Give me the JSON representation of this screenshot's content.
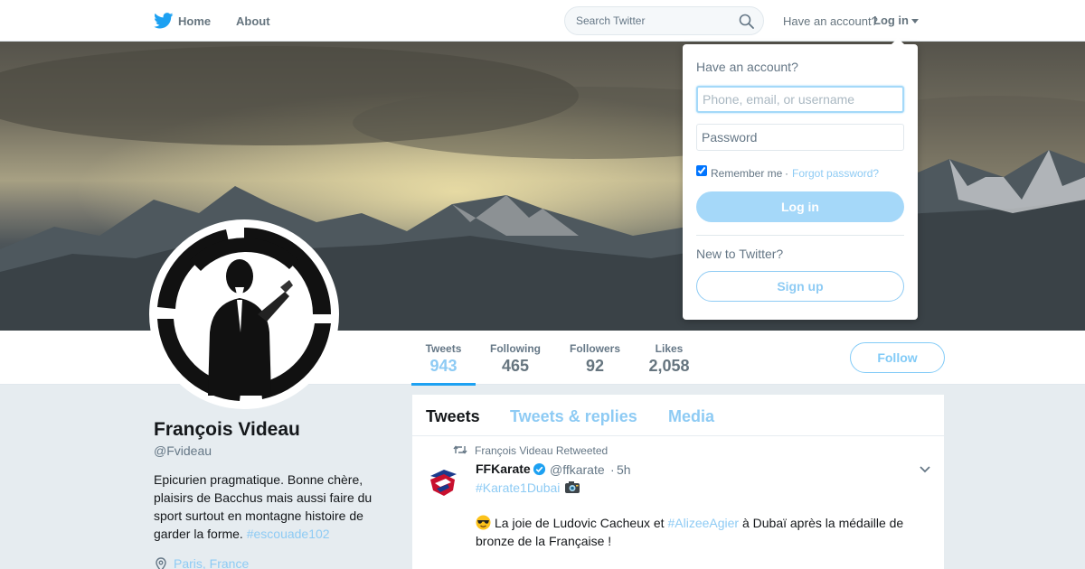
{
  "nav": {
    "home": "Home",
    "about": "About",
    "search_placeholder": "Search Twitter",
    "have_account": "Have an account?",
    "login": "Log in"
  },
  "login_dropdown": {
    "title": "Have an account?",
    "username_placeholder": "Phone, email, or username",
    "password_placeholder": "Password",
    "remember_me": "Remember me",
    "separator": "·",
    "forgot_password": "Forgot password?",
    "login_button": "Log in",
    "new_to_twitter": "New to Twitter?",
    "signup_button": "Sign up"
  },
  "stats": [
    {
      "label": "Tweets",
      "value": "943"
    },
    {
      "label": "Following",
      "value": "465"
    },
    {
      "label": "Followers",
      "value": "92"
    },
    {
      "label": "Likes",
      "value": "2,058"
    }
  ],
  "follow_button": "Follow",
  "profile": {
    "name": "François Videau",
    "handle": "@Fvideau",
    "bio": "Epicurien pragmatique. Bonne chère, plaisirs de Bacchus mais aussi faire du sport surtout en montagne histoire de garder la forme.",
    "bio_hashtag": "#escouade102",
    "location": "Paris, France"
  },
  "timeline": {
    "tabs": [
      "Tweets",
      "Tweets & replies",
      "Media"
    ],
    "tweet": {
      "retweeted_by": "François Videau Retweeted",
      "author_name": "FFKarate",
      "author_handle": "@ffkarate",
      "dot": "·",
      "time": "5h",
      "hashtag_line": "#Karate1Dubai",
      "body_1": "La joie de Ludovic Cacheux et ",
      "body_mention": "#AlizeeAgier",
      "body_2": " à Dubaï après la médaille de bronze de la Française !"
    }
  },
  "colors": {
    "accent": "#1da1f2",
    "accent_light": "#8ecbf4",
    "background": "#e6ecf0"
  }
}
